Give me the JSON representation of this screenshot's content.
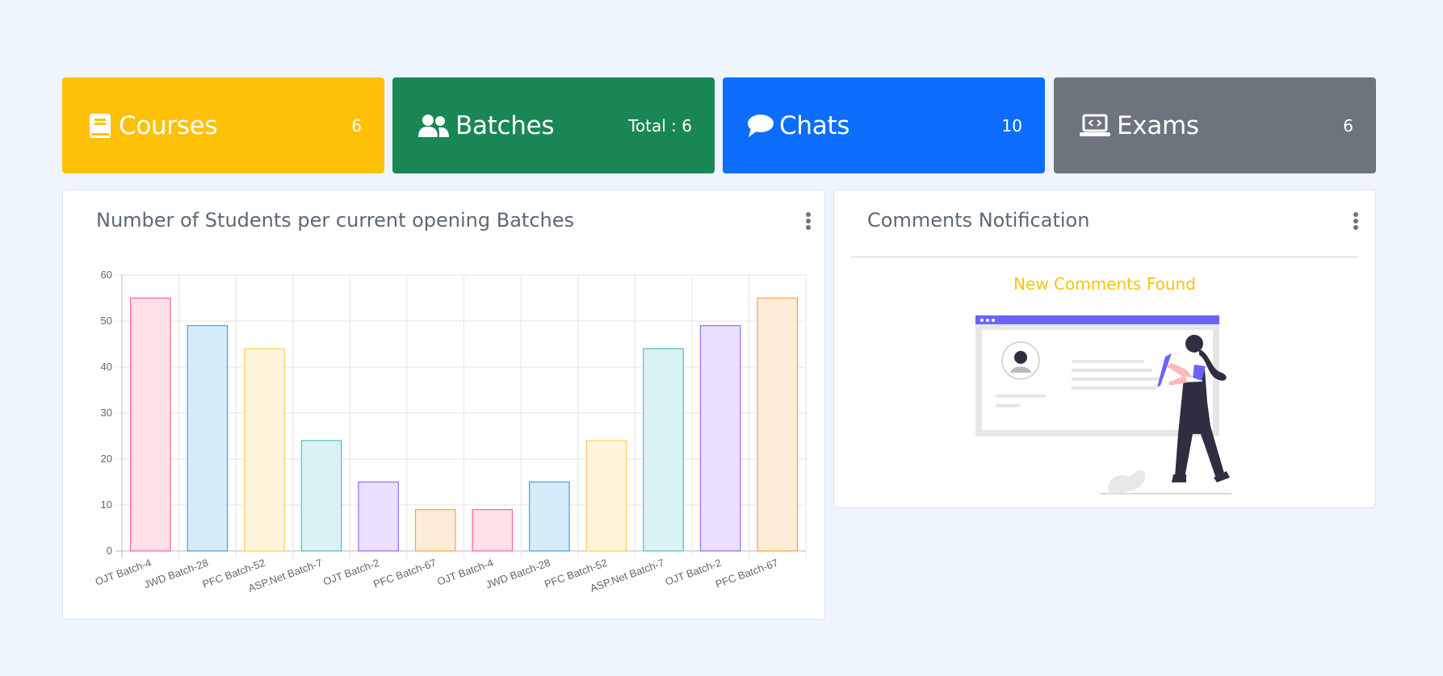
{
  "cards": [
    {
      "title": "Courses",
      "count": "6",
      "icon": "book-icon",
      "color": "#ffc107"
    },
    {
      "title": "Batches",
      "count": "Total : 6",
      "icon": "users-icon",
      "color": "#198754"
    },
    {
      "title": "Chats",
      "count": "10",
      "icon": "chat-bubble-icon",
      "color": "#0d6efd"
    },
    {
      "title": "Exams",
      "count": "6",
      "icon": "laptop-code-icon",
      "color": "#6c757d"
    }
  ],
  "chart_panel": {
    "title": "Number of Students per current opening Batches"
  },
  "comments_panel": {
    "title": "Comments Notification",
    "message": "New Comments Found",
    "illustration": "woman-drawing-on-board-illustration"
  },
  "chart_data": {
    "type": "bar",
    "title": "Number of Students per current opening Batches",
    "xlabel": "",
    "ylabel": "",
    "ylim": [
      0,
      60
    ],
    "yticks": [
      0,
      10,
      20,
      30,
      40,
      50,
      60
    ],
    "grid": true,
    "categories": [
      "OJT Batch-4",
      "JWD Batch-28",
      "PFC Batch-52",
      "ASP.Net Batch-7",
      "OJT Batch-2",
      "PFC Batch-67",
      "OJT Batch-4",
      "JWD Batch-28",
      "PFC Batch-52",
      "ASP.Net Batch-7",
      "OJT Batch-2",
      "PFC Batch-67"
    ],
    "values": [
      55,
      49,
      44,
      24,
      15,
      9,
      9,
      15,
      24,
      44,
      49,
      55
    ],
    "fill_colors": [
      "#ffe0e6",
      "#d7ecfb",
      "#fff5dd",
      "#dbf2f2",
      "#ebe0ff",
      "#ffecd9",
      "#ffe0e6",
      "#d7ecfb",
      "#fff5dd",
      "#dbf2f2",
      "#ebe0ff",
      "#ffecd9"
    ],
    "border_colors": [
      "#ff6384",
      "#36a2eb",
      "#ffcd56",
      "#4bc0c0",
      "#9966ff",
      "#ff9f40",
      "#ff6384",
      "#36a2eb",
      "#ffcd56",
      "#4bc0c0",
      "#9966ff",
      "#ff9f40"
    ]
  }
}
